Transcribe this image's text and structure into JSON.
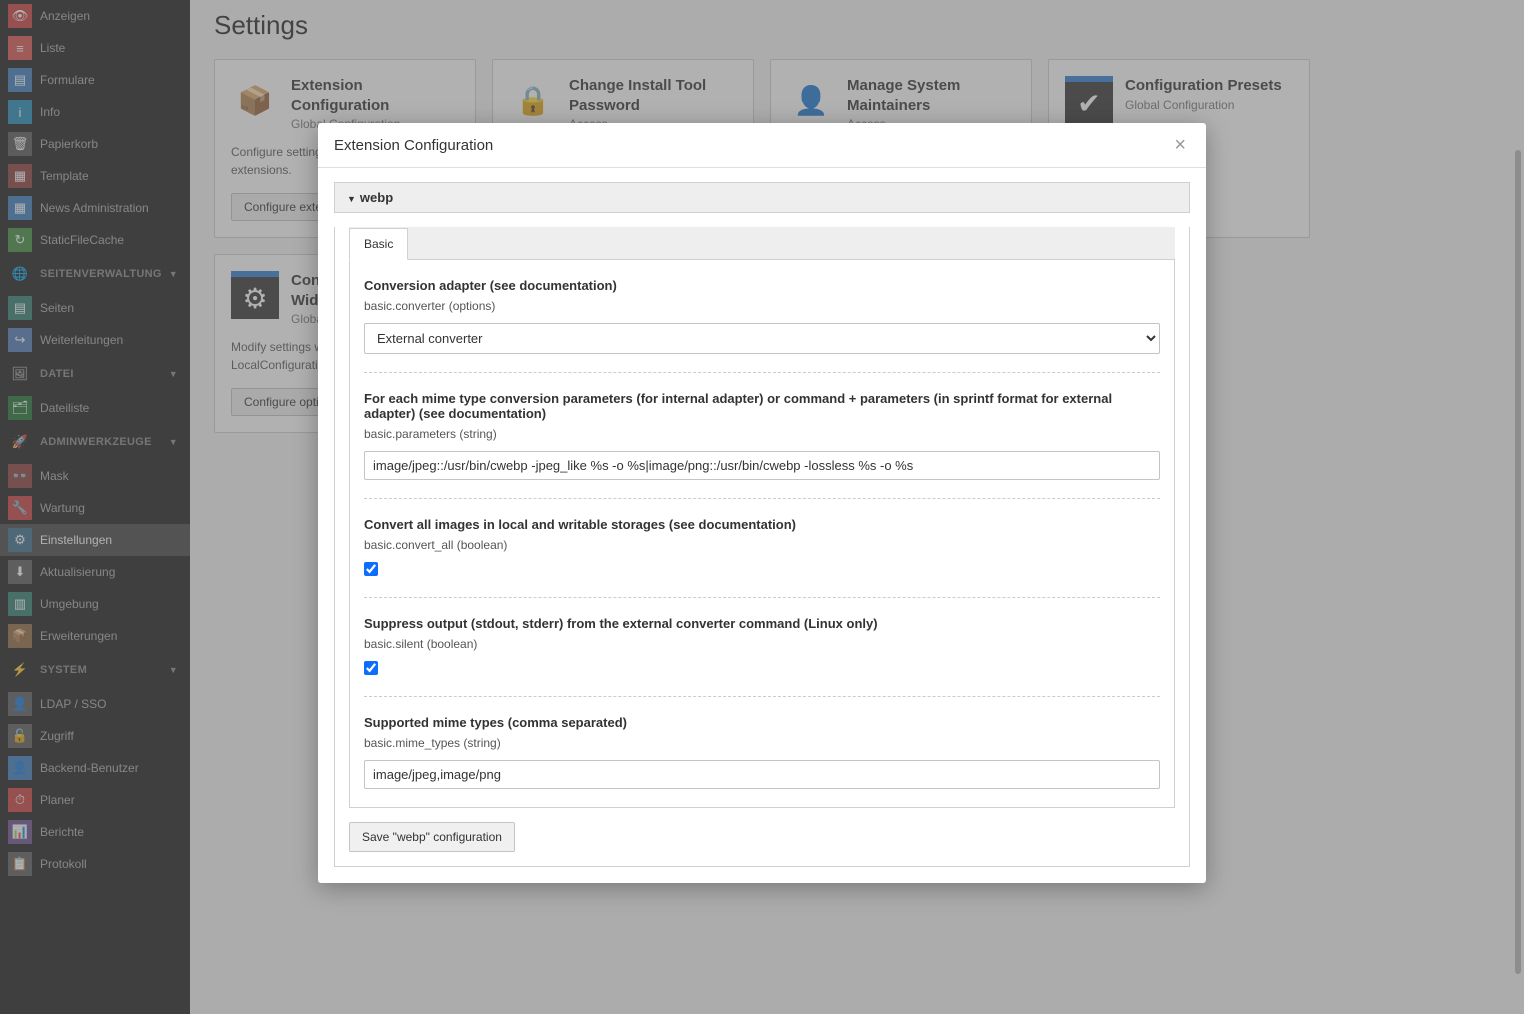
{
  "page": {
    "title": "Settings"
  },
  "sidebar": {
    "top_items": [
      {
        "label": "Anzeigen",
        "icon": "👁",
        "icon_class": "ic-red"
      },
      {
        "label": "Liste",
        "icon": "≡",
        "icon_class": "ic-lightred"
      },
      {
        "label": "Formulare",
        "icon": "▤",
        "icon_class": "ic-blue"
      },
      {
        "label": "Info",
        "icon": "i",
        "icon_class": "ic-cyan"
      },
      {
        "label": "Papierkorb",
        "icon": "🗑",
        "icon_class": "ic-darkgrey"
      },
      {
        "label": "Template",
        "icon": "▦",
        "icon_class": "ic-darkred"
      },
      {
        "label": "News Administration",
        "icon": "▦",
        "icon_class": "ic-blue"
      },
      {
        "label": "StaticFileCache",
        "icon": "↻",
        "icon_class": "ic-green"
      }
    ],
    "section_site": {
      "label": "SEITENVERWALTUNG",
      "icon": "🌐"
    },
    "site_items": [
      {
        "label": "Seiten",
        "icon": "▤",
        "icon_class": "ic-teal"
      },
      {
        "label": "Weiterleitungen",
        "icon": "↪",
        "icon_class": "ic-lightblue"
      }
    ],
    "section_file": {
      "label": "DATEI",
      "icon": "🖼"
    },
    "file_items": [
      {
        "label": "Dateiliste",
        "icon": "🗂",
        "icon_class": "ic-darkgreen"
      }
    ],
    "section_admin": {
      "label": "ADMINWERKZEUGE",
      "icon": "🚀"
    },
    "admin_items": [
      {
        "label": "Mask",
        "icon": "👓",
        "icon_class": "ic-darkred"
      },
      {
        "label": "Wartung",
        "icon": "🔧",
        "icon_class": "ic-red"
      },
      {
        "label": "Einstellungen",
        "icon": "⚙",
        "icon_class": "ic-bluegrey",
        "active": true
      },
      {
        "label": "Aktualisierung",
        "icon": "⬇",
        "icon_class": "ic-grey"
      },
      {
        "label": "Umgebung",
        "icon": "▥",
        "icon_class": "ic-teal"
      },
      {
        "label": "Erweiterungen",
        "icon": "📦",
        "icon_class": "ic-brown"
      }
    ],
    "section_system": {
      "label": "SYSTEM",
      "icon": "⚡"
    },
    "system_items": [
      {
        "label": "LDAP / SSO",
        "icon": "👤",
        "icon_class": "ic-darkgrey2"
      },
      {
        "label": "Zugriff",
        "icon": "🔓",
        "icon_class": "ic-darkgrey2"
      },
      {
        "label": "Backend-Benutzer",
        "icon": "👤",
        "icon_class": "ic-blue"
      },
      {
        "label": "Planer",
        "icon": "⏱",
        "icon_class": "ic-red"
      },
      {
        "label": "Berichte",
        "icon": "📊",
        "icon_class": "ic-purple"
      },
      {
        "label": "Protokoll",
        "icon": "📋",
        "icon_class": "ic-darkgrey2"
      }
    ]
  },
  "cards": [
    {
      "title": "Extension Configuration",
      "sub": "Global Configuration",
      "desc": "Configure settings for all enabled extensions.",
      "btn": "Configure extensions",
      "icon": "📦",
      "icon_style": "color:#d9a441"
    },
    {
      "title": "Change Install Tool Password",
      "sub": "Access",
      "desc": "",
      "btn": "",
      "icon": "🔒",
      "icon_style": "color:#8a8a8a"
    },
    {
      "title": "Manage System Maintainers",
      "sub": "Access",
      "desc": "",
      "btn": "",
      "icon": "👤",
      "icon_style": "color:#d9a441"
    },
    {
      "title": "Configuration Presets",
      "sub": "Global Configuration",
      "desc": "",
      "btn": "",
      "icon": "✔",
      "icon_style": "background:#333;color:#fff;border-top:6px solid #2d7dd2"
    },
    {
      "title": "Configure Installation-Wide Options",
      "sub": "Global Configuration",
      "desc": "Modify settings written to LocalConfiguration.php.",
      "btn": "Configure options",
      "icon": "⚙",
      "icon_style": "background:#333;color:#fff;border-top:6px solid #2d7dd2"
    }
  ],
  "modal": {
    "title": "Extension Configuration",
    "accordion_label": "webp",
    "tab_label": "Basic",
    "save_btn": "Save \"webp\" configuration",
    "fields": {
      "converter": {
        "label": "Conversion adapter (see documentation)",
        "key": "basic.converter (options)",
        "value": "External converter"
      },
      "parameters": {
        "label": "For each mime type conversion parameters (for internal adapter) or command + parameters (in sprintf format for external adapter) (see documentation)",
        "key": "basic.parameters (string)",
        "value": "image/jpeg::/usr/bin/cwebp -jpeg_like %s -o %s|image/png::/usr/bin/cwebp -lossless %s -o %s"
      },
      "convert_all": {
        "label": "Convert all images in local and writable storages (see documentation)",
        "key": "basic.convert_all (boolean)",
        "checked": true
      },
      "silent": {
        "label": "Suppress output (stdout, stderr) from the external converter command (Linux only)",
        "key": "basic.silent (boolean)",
        "checked": true
      },
      "mime_types": {
        "label": "Supported mime types (comma separated)",
        "key": "basic.mime_types (string)",
        "value": "image/jpeg,image/png"
      }
    }
  }
}
